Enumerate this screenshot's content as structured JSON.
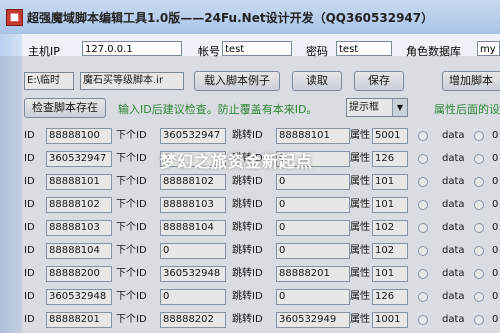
{
  "title": "超强魔域脚本编辑工具1.0版——24Fu.Net设计开发（QQ360532947）",
  "fields": {
    "host_label": "主机IP",
    "host_value": "127.0.0.1",
    "account_label": "帐号",
    "account_value": "test",
    "password_label": "密码",
    "password_value": "test",
    "db_label": "角色数据库",
    "db_value": "my"
  },
  "path": {
    "file_path": "E:\\临时",
    "script_name": "魔石买等级脚本.ir"
  },
  "toolbar": {
    "load_example": "载入脚本例子",
    "read": "读取",
    "save": "保存",
    "add_script": "增加脚本",
    "check_exists": "检查脚本存在",
    "hint_text": "输入ID后建议检查。防止覆盖有本来ID。",
    "mode_select": "提示框",
    "property_hint": "属性后面的设"
  },
  "labels": {
    "id": "ID",
    "next_id": "下个ID",
    "jump_id": "跳转ID",
    "attr": "属性",
    "data": "data"
  },
  "watermark": "梦幻之旅资金新起点",
  "rows": [
    {
      "id": "88888100",
      "next": "360532947",
      "jump": "88888101",
      "attr": "5001",
      "data": "0"
    },
    {
      "id": "360532947",
      "next": "0",
      "jump": "0",
      "attr": "126",
      "data": "0"
    },
    {
      "id": "88888101",
      "next": "88888102",
      "jump": "0",
      "attr": "101",
      "data": "0"
    },
    {
      "id": "88888102",
      "next": "88888103",
      "jump": "0",
      "attr": "101",
      "data": "0"
    },
    {
      "id": "88888103",
      "next": "88888104",
      "jump": "0",
      "attr": "102",
      "data": "0"
    },
    {
      "id": "88888104",
      "next": "0",
      "jump": "0",
      "attr": "102",
      "data": "0"
    },
    {
      "id": "88888200",
      "next": "360532948",
      "jump": "88888201",
      "attr": "101",
      "data": "0"
    },
    {
      "id": "360532948",
      "next": "0",
      "jump": "0",
      "attr": "126",
      "data": "0"
    },
    {
      "id": "88888201",
      "next": "88888202",
      "jump": "360532949",
      "attr": "1001",
      "data": "0"
    }
  ]
}
